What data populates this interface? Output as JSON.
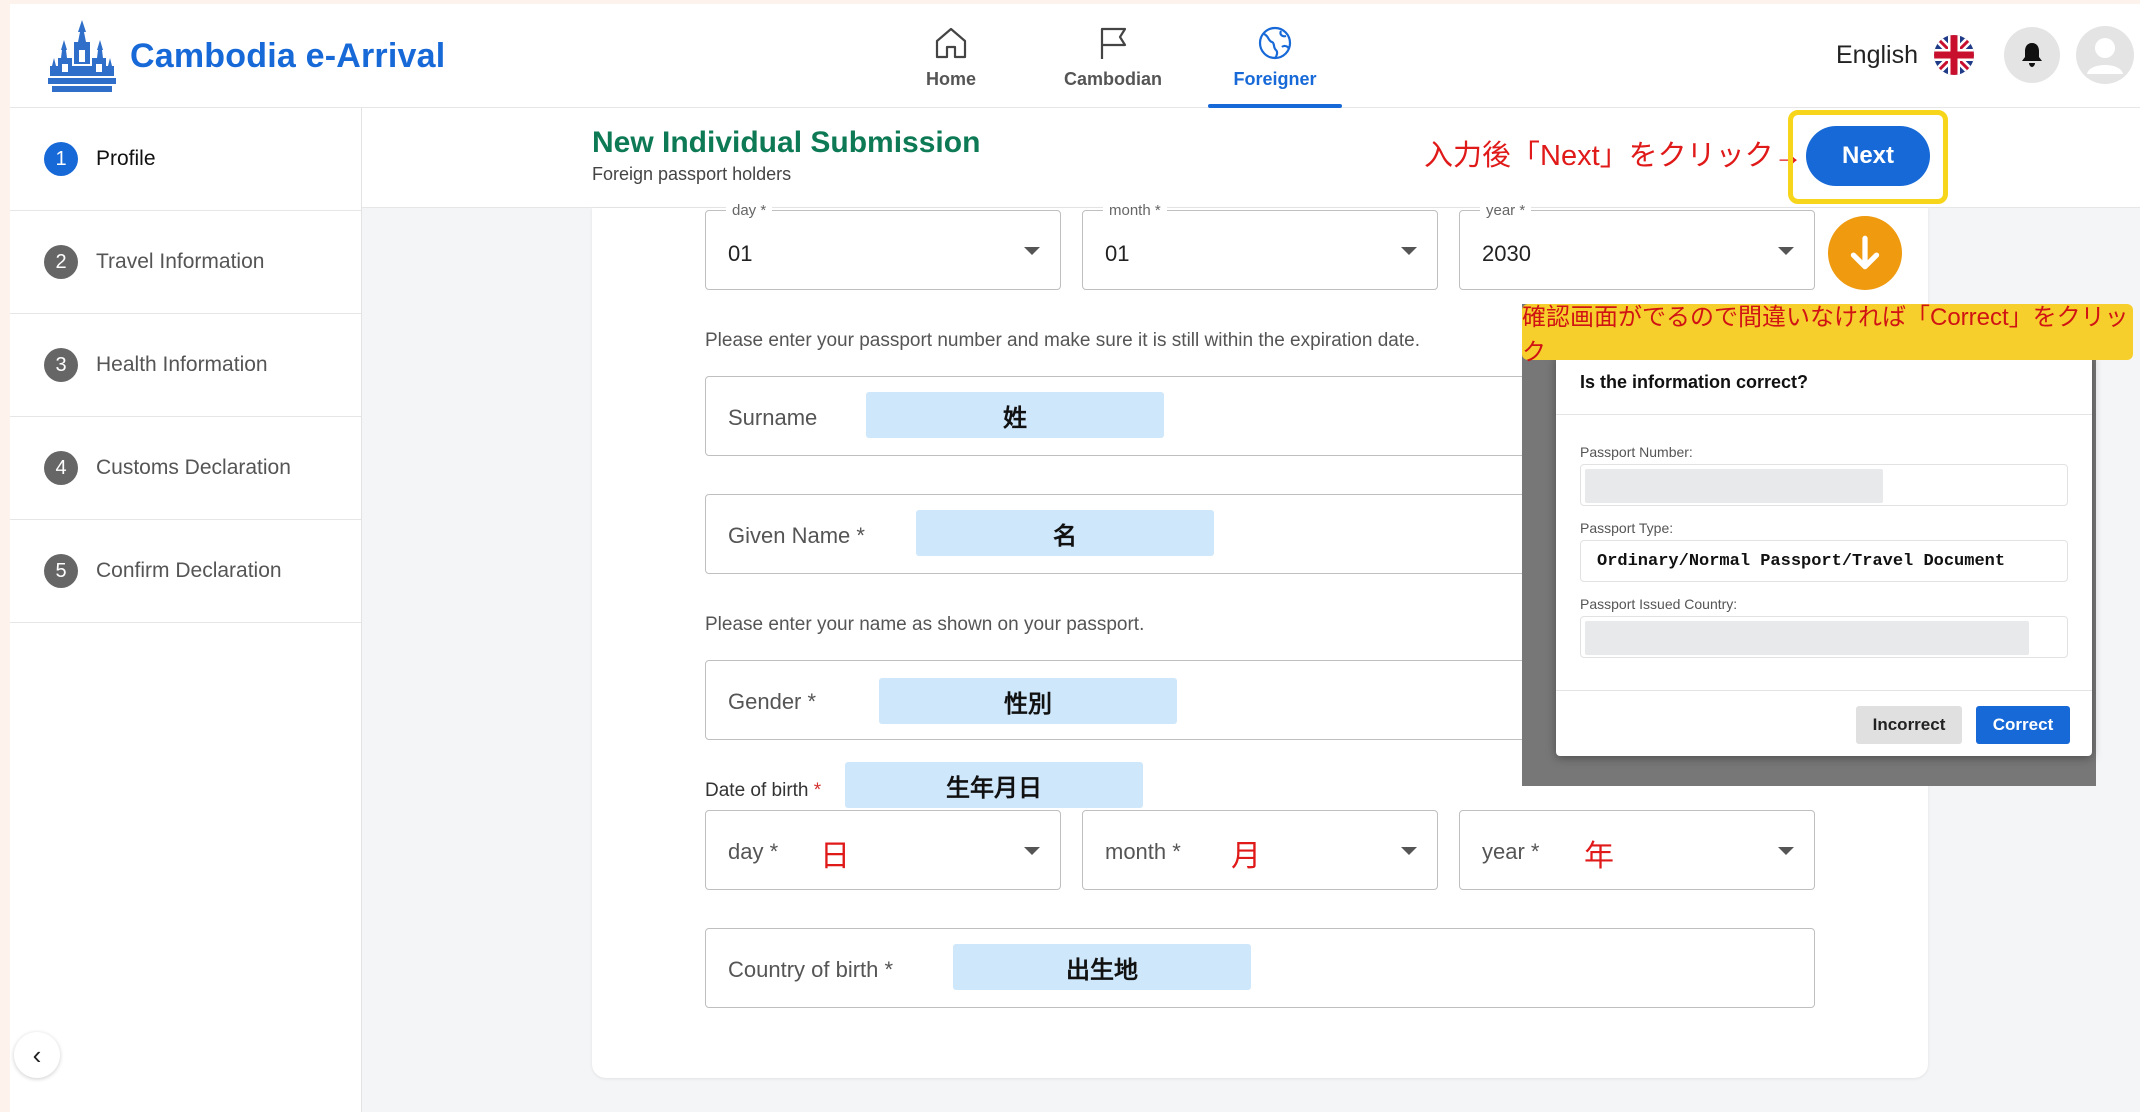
{
  "header": {
    "brand": "Cambodia e-Arrival",
    "nav": [
      {
        "label": "Home",
        "icon": "home-icon"
      },
      {
        "label": "Cambodian",
        "icon": "flag-icon"
      },
      {
        "label": "Foreigner",
        "icon": "globe-icon",
        "active": true
      }
    ],
    "language": "English"
  },
  "sidebar": {
    "steps": [
      {
        "num": "1",
        "label": "Profile",
        "active": true
      },
      {
        "num": "2",
        "label": "Travel Information"
      },
      {
        "num": "3",
        "label": "Health Information"
      },
      {
        "num": "4",
        "label": "Customs Declaration"
      },
      {
        "num": "5",
        "label": "Confirm Declaration"
      }
    ]
  },
  "titlebar": {
    "title": "New Individual Submission",
    "subtitle": "Foreign passport holders",
    "annotation": "入力後「Next」をクリック→",
    "next_label": "Next"
  },
  "form": {
    "expiry": {
      "day": {
        "label": "day *",
        "value": "01"
      },
      "month": {
        "label": "month *",
        "value": "01"
      },
      "year": {
        "label": "year *",
        "value": "2030"
      }
    },
    "passport_helper": "Please enter your passport number and make sure it is still within the expiration date.",
    "surname": {
      "label": "Surname",
      "hint": "姓"
    },
    "given_name": {
      "label": "Given Name *",
      "hint": "名"
    },
    "name_helper": "Please enter your name as shown on your passport.",
    "gender": {
      "label": "Gender *",
      "hint": "性別"
    },
    "dob": {
      "label": "Date of birth",
      "required_mark": "*",
      "hint": "生年月日",
      "day": {
        "label": "day *",
        "note": "日"
      },
      "month": {
        "label": "month *",
        "note": "月"
      },
      "year": {
        "label": "year *",
        "note": "年"
      }
    },
    "country_of_birth": {
      "label": "Country of birth *",
      "hint": "出生地"
    }
  },
  "confirm": {
    "annotation": "確認画面がでるので間違いなければ「Correct」をクリック",
    "title": "Is the information correct?",
    "passport_number_label": "Passport Number:",
    "passport_type_label": "Passport Type:",
    "passport_type_value": "Ordinary/Normal Passport/Travel Document",
    "issued_country_label": "Passport Issued Country:",
    "incorrect_label": "Incorrect",
    "correct_label": "Correct"
  },
  "colors": {
    "primary": "#1769d8",
    "title_green": "#0d7a55",
    "annotation_red": "#e01919",
    "highlight_yellow": "#f7d51a",
    "arrow_orange": "#ef9a0f",
    "hint_blue": "#cfe7fb"
  }
}
